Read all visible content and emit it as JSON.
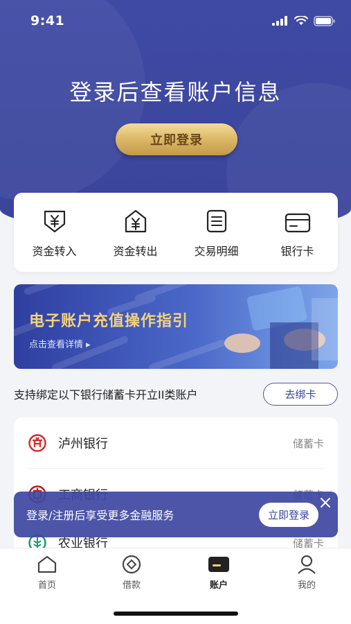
{
  "status_bar": {
    "time": "9:41"
  },
  "header": {
    "title": "登录后查看账户信息",
    "login_button": "立即登录"
  },
  "actions": [
    {
      "label": "资金转入",
      "icon": "money-in-icon"
    },
    {
      "label": "资金转出",
      "icon": "money-out-icon"
    },
    {
      "label": "交易明细",
      "icon": "transaction-list-icon"
    },
    {
      "label": "银行卡",
      "icon": "bank-card-icon"
    }
  ],
  "banner": {
    "title": "电子账户充值操作指引",
    "subtitle": "点击查看详情 ▸"
  },
  "bind_section": {
    "text": "支持绑定以下银行储蓄卡开立II类账户",
    "button": "去绑卡"
  },
  "banks": [
    {
      "name": "泸州银行",
      "type": "储蓄卡",
      "color": "#d22c2c"
    },
    {
      "name": "工商银行",
      "type": "储蓄卡",
      "color": "#c8161d"
    },
    {
      "name": "农业银行",
      "type": "储蓄卡",
      "color": "#1a9a6a"
    }
  ],
  "toast": {
    "text": "登录/注册后享受更多金融服务",
    "button": "立即登录"
  },
  "tabbar": [
    {
      "label": "首页",
      "icon": "home-icon",
      "active": false
    },
    {
      "label": "借款",
      "icon": "loan-icon",
      "active": false
    },
    {
      "label": "账户",
      "icon": "account-card-icon",
      "active": true
    },
    {
      "label": "我的",
      "icon": "profile-icon",
      "active": false
    }
  ],
  "colors": {
    "primary": "#3a4499",
    "gold": "#d9b463",
    "banner_title": "#f6d27a"
  }
}
